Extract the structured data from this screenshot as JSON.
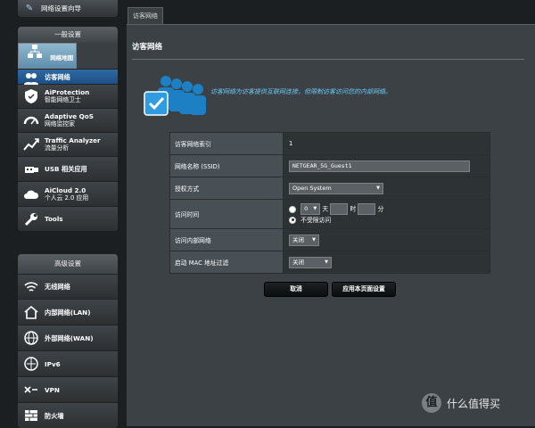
{
  "sidebar": {
    "top_item": "网络设置向导",
    "general": {
      "header": "一般设置",
      "items": [
        {
          "label": "网络地图",
          "sub": "",
          "icon": "network-map-icon"
        },
        {
          "label": "访客网络",
          "sub": "",
          "icon": "guest-network-icon"
        },
        {
          "label": "AiProtection",
          "sub": "智能网络卫士",
          "icon": "aiprotection-icon"
        },
        {
          "label": "Adaptive QoS",
          "sub": "网络监控家",
          "icon": "qos-gauge-icon"
        },
        {
          "label": "Traffic Analyzer",
          "sub": "流量分析",
          "icon": "traffic-analyzer-icon"
        },
        {
          "label": "USB 相关应用",
          "sub": "",
          "icon": "usb-icon"
        },
        {
          "label": "AiCloud 2.0",
          "sub": "个人云 2.0 应用",
          "icon": "cloud-icon"
        },
        {
          "label": "Tools",
          "sub": "",
          "icon": "wrench-icon"
        }
      ]
    },
    "advanced": {
      "header": "高级设置",
      "items": [
        {
          "label": "无线网络",
          "icon": "wifi-icon"
        },
        {
          "label": "内部网络(LAN)",
          "icon": "home-icon"
        },
        {
          "label": "外部网络(WAN)",
          "icon": "globe-icon"
        },
        {
          "label": "IPv6",
          "icon": "ipv6-icon"
        },
        {
          "label": "VPN",
          "icon": "vpn-icon"
        },
        {
          "label": "防火墙",
          "icon": "firewall-icon"
        }
      ]
    }
  },
  "main": {
    "tab_label": "访客网络",
    "title": "访客网络",
    "description": "访客网络为访客提供互联网连接，但限制访客访问您的内部网络。",
    "form": {
      "index_label": "访客网络索引",
      "index_value": "1",
      "ssid_label": "网络名称 (SSID)",
      "ssid_value": "NETGEAR_5G_Guest1",
      "auth_label": "授权方式",
      "auth_value": "Open System",
      "time_label": "访问时间",
      "time_day_value": "0",
      "time_day_unit": "天",
      "time_hour_unit": "时",
      "time_min_unit": "分",
      "time_unlimited": "不受限访问",
      "intranet_label": "访问内部网络",
      "intranet_value": "关闭",
      "mac_label": "启动 MAC 地址过滤",
      "mac_value": "关闭"
    },
    "buttons": {
      "cancel": "取消",
      "apply": "应用本页面设置"
    }
  },
  "watermark": {
    "logo_char": "值",
    "text": "什么值得买"
  }
}
